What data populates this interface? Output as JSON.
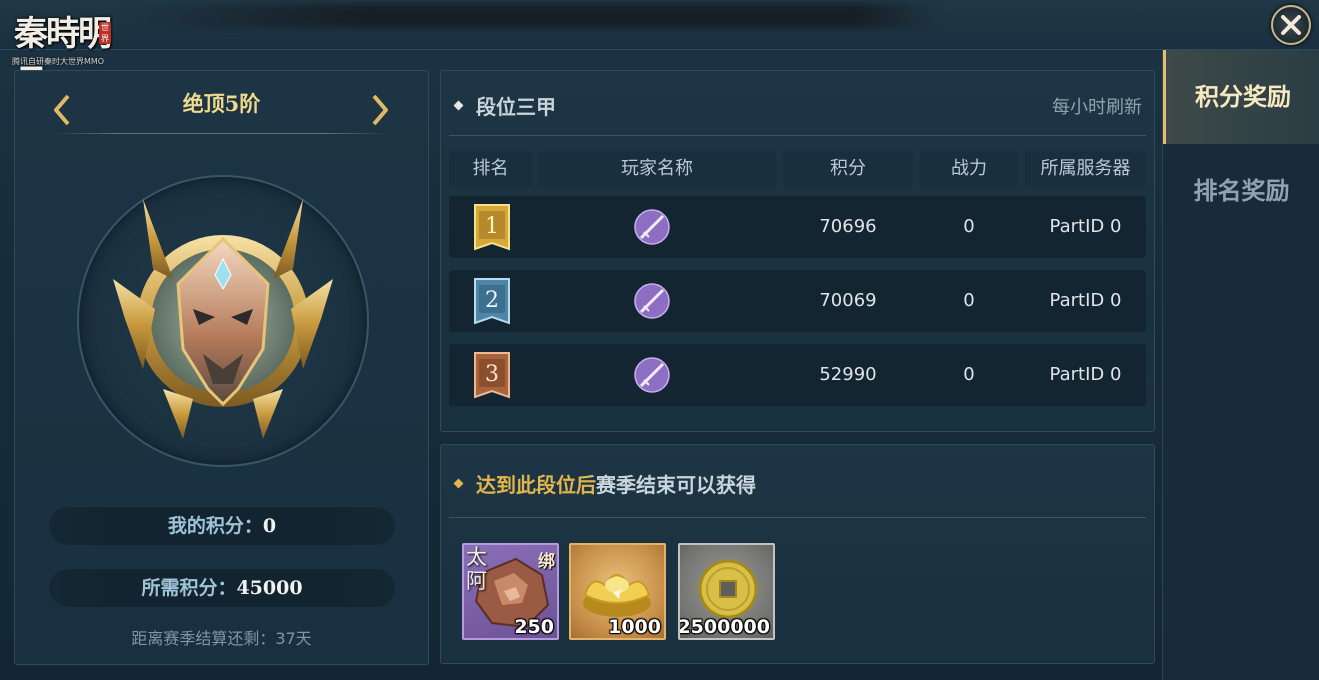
{
  "logo": {
    "title": "秦時明月",
    "seal": "世界",
    "subtitle": "腾讯自研秦时大世界MMO"
  },
  "close": {
    "icon": "close-icon"
  },
  "left": {
    "rank_title": "绝顶5阶",
    "my_score_label": "我的积分：",
    "my_score_value": "0",
    "need_score_label": "所需积分：",
    "need_score_value": "45000",
    "remaining": "距离赛季结算还剩：37天"
  },
  "top3": {
    "title": "段位三甲",
    "refresh": "每小时刷新",
    "headers": {
      "rank": "排名",
      "player": "玩家名称",
      "score": "积分",
      "power": "战力",
      "server": "所属服务器"
    },
    "rows": [
      {
        "rank": "1",
        "score": "70696",
        "power": "0",
        "server": "PartID 0",
        "medal_color": "#d4a93a"
      },
      {
        "rank": "2",
        "score": "70069",
        "power": "0",
        "server": "PartID 0",
        "medal_color": "#4f86a8"
      },
      {
        "rank": "3",
        "score": "52990",
        "power": "0",
        "server": "PartID 0",
        "medal_color": "#a8643c"
      }
    ]
  },
  "reward": {
    "title_highlight": "达到此段位后",
    "title_rest": "赛季结束可以获得",
    "items": [
      {
        "tag": "太阿",
        "bind": "绑",
        "qty": "250",
        "icon": "ore-icon"
      },
      {
        "qty": "1000",
        "icon": "gold-ingot-icon"
      },
      {
        "qty": "2500000",
        "icon": "coin-icon"
      }
    ]
  },
  "tabs": {
    "active": "积分奖励",
    "inactive": "排名奖励"
  },
  "colors": {
    "accent_gold": "#e3b64a",
    "title_gold": "#f0d88c",
    "panel": "#1c3443"
  }
}
